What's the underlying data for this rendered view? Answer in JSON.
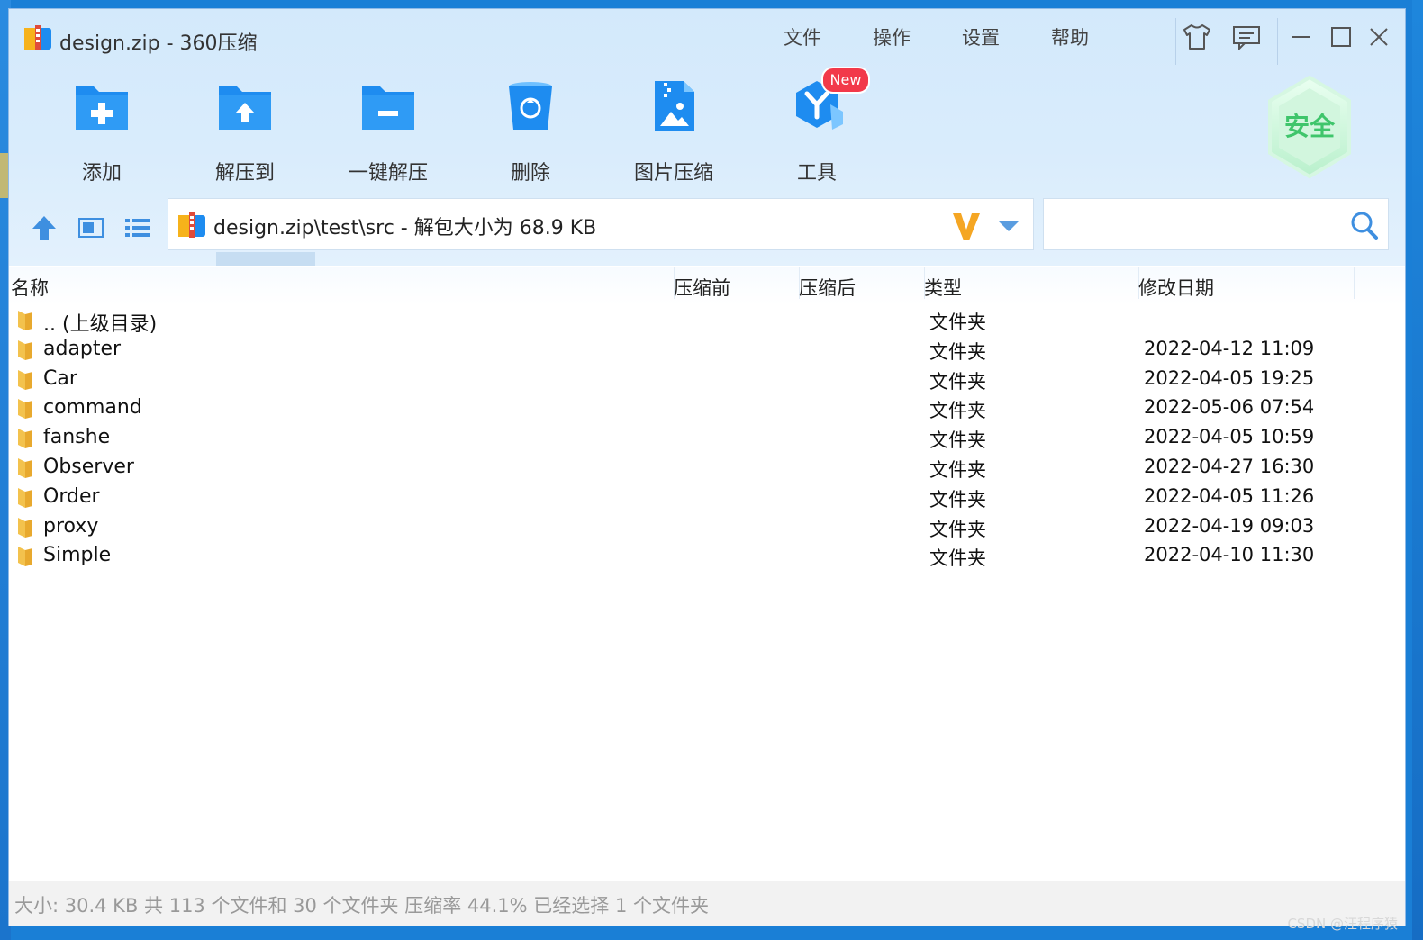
{
  "window": {
    "title": "design.zip - 360压缩"
  },
  "menu": {
    "items": [
      "文件",
      "操作",
      "设置",
      "帮助"
    ]
  },
  "window_controls": {
    "icons": [
      "shirt-icon",
      "feedback-icon",
      "minimize-icon",
      "maximize-icon",
      "close-icon"
    ]
  },
  "toolbar": {
    "items": [
      {
        "label": "添加",
        "icon": "add-folder-icon"
      },
      {
        "label": "解压到",
        "icon": "extract-to-icon"
      },
      {
        "label": "一键解压",
        "icon": "quick-extract-icon"
      },
      {
        "label": "删除",
        "icon": "delete-icon"
      },
      {
        "label": "图片压缩",
        "icon": "image-compress-icon"
      },
      {
        "label": "工具",
        "icon": "tools-icon"
      }
    ],
    "new_badge": "New",
    "security_badge": "安全"
  },
  "navigation": {
    "address": "design.zip\\test\\src - 解包大小为 68.9 KB",
    "search_placeholder": ""
  },
  "columns": {
    "name": "名称",
    "before": "压缩前",
    "after": "压缩后",
    "type": "类型",
    "modified": "修改日期"
  },
  "files": [
    {
      "name": ".. (上级目录)",
      "type": "文件夹",
      "date": ""
    },
    {
      "name": "adapter",
      "type": "文件夹",
      "date": "2022-04-12 11:09"
    },
    {
      "name": "Car",
      "type": "文件夹",
      "date": "2022-04-05 19:25"
    },
    {
      "name": "command",
      "type": "文件夹",
      "date": "2022-05-06 07:54"
    },
    {
      "name": "fanshe",
      "type": "文件夹",
      "date": "2022-04-05 10:59"
    },
    {
      "name": "Observer",
      "type": "文件夹",
      "date": "2022-04-27 16:30"
    },
    {
      "name": "Order",
      "type": "文件夹",
      "date": "2022-04-05 11:26"
    },
    {
      "name": "proxy",
      "type": "文件夹",
      "date": "2022-04-19 09:03"
    },
    {
      "name": "Simple",
      "type": "文件夹",
      "date": "2022-04-10 11:30"
    }
  ],
  "status": {
    "text": "大小: 30.4 KB 共 113 个文件和 30 个文件夹 压缩率 44.1% 已经选择 1 个文件夹"
  },
  "watermark": "CSDN @汪程序猿",
  "colors": {
    "accent": "#1e8cf0",
    "titlebar": "#d6ebfc",
    "new_badge": "#f2394a",
    "security_green": "#3fc56b"
  }
}
